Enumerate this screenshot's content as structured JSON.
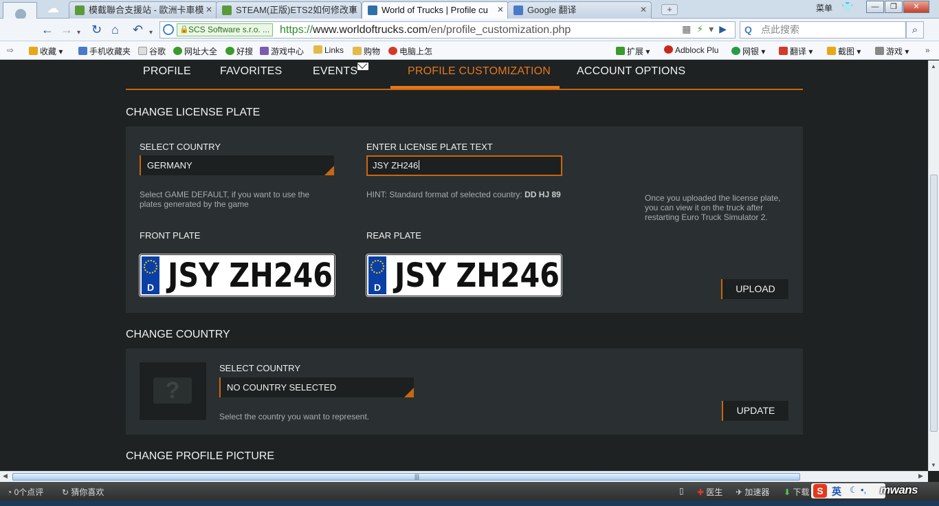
{
  "browser": {
    "tabs": [
      {
        "title": "模截聯合支援站 - 歐洲卡車模",
        "favicon_color": "#5b9a3a"
      },
      {
        "title": "STEAM(正版)ETS2如何修改車",
        "favicon_color": "#5b9a3a"
      },
      {
        "title": "World of Trucks | Profile cu",
        "favicon_color": "#2f6fa8"
      },
      {
        "title": "Google 翻译",
        "favicon_color": "#4a7ac9"
      }
    ],
    "new_tab_label": "+",
    "menu_label": "菜单",
    "ssl_label": "SCS Software s.r.o. ...",
    "url": {
      "scheme": "https://",
      "host": "www.worldoftrucks.com",
      "path": "/en/profile_customization.php"
    },
    "search_placeholder": "点此搜索",
    "bookmarks": [
      {
        "label": "收藏",
        "color": "#e6a817"
      },
      {
        "label": "手机收藏夹",
        "color": "#4a7ac9"
      },
      {
        "label": "谷歌",
        "color": "#cccccc"
      },
      {
        "label": "网址大全",
        "color": "#3a9a2a"
      },
      {
        "label": "好搜",
        "color": "#3a9a2a"
      },
      {
        "label": "游戏中心",
        "color": "#7a5bb0"
      },
      {
        "label": "Links",
        "color": "#e6b84a"
      },
      {
        "label": "购物",
        "color": "#e6b84a"
      },
      {
        "label": "电脑上怎",
        "color": "#d43a2a"
      },
      {
        "label": "扩展",
        "color": "#3a9a2a"
      },
      {
        "label": "Adblock Plu",
        "color": "#c8281c"
      },
      {
        "label": "网银",
        "color": "#2a9a4a"
      },
      {
        "label": "翻译",
        "color": "#d43a2a"
      },
      {
        "label": "截图",
        "color": "#e6a817"
      },
      {
        "label": "游戏",
        "color": "#666666"
      }
    ]
  },
  "site_nav": {
    "items": [
      {
        "label": "Profile"
      },
      {
        "label": "Favorites"
      },
      {
        "label": "Events"
      },
      {
        "label": "Profile Customization"
      },
      {
        "label": "Account Options"
      }
    ],
    "active": "Profile Customization",
    "accent_color": "#e7771c"
  },
  "license_plate": {
    "section_title": "Change License Plate",
    "country_label": "Select Country",
    "country_value": "Germany",
    "country_hint": "Select GAME DEFAULT, if you want to use the plates generated by the game",
    "text_label": "Enter License Plate Text",
    "text_value": "JSY ZH246",
    "hint_prefix": "HINT: Standard format of selected country:",
    "hint_format": "DD HJ 89",
    "upload_note": "Once you uploaded the license plate, you can view it on the truck after restarting Euro Truck Simulator 2.",
    "front_label": "Front Plate",
    "rear_label": "Rear Plate",
    "plate_text": "JSY ZH246",
    "plate_country_code": "D",
    "upload_button": "Upload"
  },
  "country": {
    "section_title": "Change Country",
    "select_label": "Select Country",
    "select_value": "No country selected",
    "hint": "Select the country you want to represent.",
    "placeholder_glyph": "?",
    "update_button": "Update"
  },
  "profile_picture": {
    "section_title": "Change Profile Picture"
  },
  "statusbar": {
    "left_items": [
      "0个点评",
      "猜你喜欢"
    ],
    "right_items": [
      "医生",
      "加速器",
      "下载"
    ],
    "ime_label": "英",
    "ime_logo": "S",
    "watermark": "mwans"
  }
}
